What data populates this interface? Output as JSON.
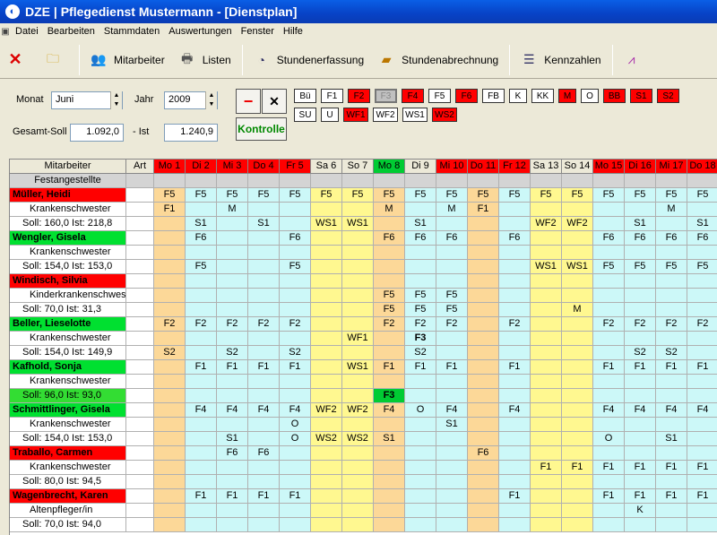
{
  "window": {
    "title": "DZE  |  Pflegedienst Mustermann - [Dienstplan]"
  },
  "menu": [
    "Datei",
    "Bearbeiten",
    "Stammdaten",
    "Auswertungen",
    "Fenster",
    "Hilfe"
  ],
  "toolbar": {
    "mitarbeiter": "Mitarbeiter",
    "listen": "Listen",
    "stundenerfassung": "Stundenerfassung",
    "stundenabrechnung": "Stundenabrechnung",
    "kennzahlen": "Kennzahlen"
  },
  "filter": {
    "monat_label": "Monat",
    "monat_value": "Juni",
    "jahr_label": "Jahr",
    "jahr_value": "2009",
    "gesamt_soll_label": "Gesamt-Soll",
    "gesamt_soll_value": "1.092,0",
    "ist_label": "- Ist",
    "ist_value": "1.240,9",
    "minus_label": "−",
    "close_label": "✕",
    "kontrolle_label": "Kontrolle"
  },
  "shift_buttons_row1": [
    {
      "label": "Bü",
      "style": "white"
    },
    {
      "label": "F1",
      "style": "white"
    },
    {
      "label": "F2",
      "style": "red"
    },
    {
      "label": "F3",
      "style": "gray"
    },
    {
      "label": "F4",
      "style": "redt"
    },
    {
      "label": "F5",
      "style": "white"
    },
    {
      "label": "F6",
      "style": "red"
    },
    {
      "label": "FB",
      "style": "white"
    },
    {
      "label": "K",
      "style": "white"
    },
    {
      "label": "KK",
      "style": "white"
    },
    {
      "label": "M",
      "style": "red"
    },
    {
      "label": "O",
      "style": "white"
    },
    {
      "label": "BB",
      "style": "red"
    },
    {
      "label": "S1",
      "style": "red"
    },
    {
      "label": "S2",
      "style": "red"
    }
  ],
  "shift_buttons_row2": [
    {
      "label": "SU",
      "style": "white"
    },
    {
      "label": "U",
      "style": "white"
    },
    {
      "label": "WF1",
      "style": "red"
    },
    {
      "label": "WF2",
      "style": "white"
    },
    {
      "label": "WS1",
      "style": "white"
    },
    {
      "label": "WS2",
      "style": "red"
    }
  ],
  "grid": {
    "col_mitarbeiter": "Mitarbeiter",
    "col_art": "Art",
    "days": [
      "Mo 1",
      "Di 2",
      "Mi 3",
      "Do 4",
      "Fr 5",
      "Sa 6",
      "So 7",
      "Mo 8",
      "Di 9",
      "Mi 10",
      "Do 11",
      "Fr 12",
      "Sa 13",
      "So 14",
      "Mo 15",
      "Di 16",
      "Mi 17",
      "Do 18"
    ],
    "day_header_styles": [
      "red",
      "red",
      "red",
      "red",
      "red",
      "plain",
      "plain",
      "green",
      "plain",
      "red",
      "red",
      "red",
      "plain",
      "plain",
      "red",
      "red",
      "red",
      "red"
    ],
    "day_types": [
      "mo",
      "wk",
      "wk",
      "wk",
      "wk",
      "we",
      "we",
      "mo",
      "wk",
      "wk",
      "mo",
      "wk",
      "we",
      "we",
      "wk",
      "wk",
      "wk",
      "wk"
    ],
    "group": "Festangestellte",
    "rows": [
      {
        "kind": "name",
        "label": "Müller, Heidi",
        "color": "red",
        "cells": [
          "F5",
          "F5",
          "F5",
          "F5",
          "F5",
          "F5",
          "F5",
          "F5",
          "F5",
          "F5",
          "F5",
          "F5",
          "F5",
          "F5",
          "F5",
          "F5",
          "F5",
          "F5"
        ]
      },
      {
        "kind": "sub",
        "label": "Krankenschwester",
        "cells": [
          "F1",
          "",
          "M",
          "",
          "",
          "",
          "",
          "M",
          "",
          "M",
          "F1",
          "",
          "",
          "",
          "",
          "",
          "M",
          ""
        ]
      },
      {
        "kind": "soll",
        "label": "Soll: 160,0 Ist: 218,8",
        "cells": [
          "",
          "S1",
          "",
          "S1",
          "",
          "WS1",
          "WS1",
          "",
          "S1",
          "",
          "",
          "",
          "WF2",
          "WF2",
          "",
          "S1",
          "",
          "S1"
        ]
      },
      {
        "kind": "name",
        "label": "Wengler, Gisela",
        "color": "green",
        "cells": [
          "",
          "F6",
          "",
          "",
          "F6",
          "",
          "",
          "F6",
          "F6",
          "F6",
          "",
          "F6",
          "",
          "",
          "F6",
          "F6",
          "F6",
          "F6"
        ]
      },
      {
        "kind": "sub",
        "label": "Krankenschwester",
        "cells": [
          "",
          "",
          "",
          "",
          "",
          "",
          "",
          "",
          "",
          "",
          "",
          "",
          "",
          "",
          "",
          "",
          "",
          ""
        ]
      },
      {
        "kind": "soll",
        "label": "Soll: 154,0 Ist: 153,0",
        "cells": [
          "",
          "F5",
          "",
          "",
          "F5",
          "",
          "",
          "",
          "",
          "",
          "",
          "",
          "WS1",
          "WS1",
          "F5",
          "F5",
          "F5",
          "F5"
        ]
      },
      {
        "kind": "name",
        "label": "Windisch, Silvia",
        "color": "red",
        "cells": [
          "",
          "",
          "",
          "",
          "",
          "",
          "",
          "",
          "",
          "",
          "",
          "",
          "",
          "",
          "",
          "",
          "",
          ""
        ]
      },
      {
        "kind": "sub",
        "label": "Kinderkrankenschwester",
        "cells": [
          "",
          "",
          "",
          "",
          "",
          "",
          "",
          "F5",
          "F5",
          "F5",
          "",
          "",
          "",
          "",
          "",
          "",
          "",
          ""
        ]
      },
      {
        "kind": "soll",
        "label": "Soll: 70,0 Ist: 31,3",
        "cells": [
          "",
          "",
          "",
          "",
          "",
          "",
          "",
          "F5",
          "F5",
          "F5",
          "",
          "",
          "",
          "M",
          "",
          "",
          "",
          ""
        ]
      },
      {
        "kind": "name",
        "label": "Beller, Lieselotte",
        "color": "green",
        "cells": [
          "F2",
          "F2",
          "F2",
          "F2",
          "F2",
          "",
          "",
          "F2",
          "F2",
          "F2",
          "",
          "F2",
          "",
          "",
          "F2",
          "F2",
          "F2",
          "F2"
        ]
      },
      {
        "kind": "sub",
        "label": "Krankenschwester",
        "cells": [
          "",
          "",
          "",
          "",
          "",
          "",
          "WF1",
          "",
          "F3b",
          "",
          "",
          "",
          "",
          "",
          "",
          "",
          "",
          ""
        ]
      },
      {
        "kind": "soll",
        "label": "Soll: 154,0 Ist: 149,9",
        "cells": [
          "S2",
          "",
          "S2",
          "",
          "S2",
          "",
          "",
          "",
          "S2",
          "",
          "",
          "",
          "",
          "",
          "",
          "S2",
          "S2",
          ""
        ]
      },
      {
        "kind": "name",
        "label": "Kafhold, Sonja",
        "color": "green",
        "cells": [
          "",
          "F1",
          "F1",
          "F1",
          "F1",
          "",
          "WS1",
          "F1",
          "F1",
          "F1",
          "",
          "F1",
          "",
          "",
          "F1",
          "F1",
          "F1",
          "F1"
        ]
      },
      {
        "kind": "sub",
        "label": "Krankenschwester",
        "cells": [
          "",
          "",
          "",
          "",
          "",
          "",
          "",
          "",
          "",
          "",
          "",
          "",
          "",
          "",
          "",
          "",
          "",
          ""
        ]
      },
      {
        "kind": "soll",
        "label": "Soll: 96,0 Ist: 93,0",
        "color": "green",
        "cells": [
          "",
          "",
          "",
          "",
          "",
          "",
          "",
          "F3g",
          "",
          "",
          "",
          "",
          "",
          "",
          "",
          "",
          "",
          ""
        ]
      },
      {
        "kind": "name",
        "label": "Schmittlinger, Gisela",
        "color": "green",
        "cells": [
          "",
          "F4",
          "F4",
          "F4",
          "F4",
          "WF2",
          "WF2",
          "F4",
          "O",
          "F4",
          "",
          "F4",
          "",
          "",
          "F4",
          "F4",
          "F4",
          "F4"
        ]
      },
      {
        "kind": "sub",
        "label": "Krankenschwester",
        "cells": [
          "",
          "",
          "",
          "",
          "O",
          "",
          "",
          "",
          "",
          "S1",
          "",
          "",
          "",
          "",
          "",
          "",
          "",
          ""
        ]
      },
      {
        "kind": "soll",
        "label": "Soll: 154,0 Ist: 153,0",
        "cells": [
          "",
          "",
          "S1",
          "",
          "O",
          "WS2",
          "WS2",
          "S1",
          "",
          "",
          "",
          "",
          "",
          "",
          "O",
          "",
          "S1",
          ""
        ]
      },
      {
        "kind": "name",
        "label": "Traballo, Carmen",
        "color": "red",
        "cells": [
          "",
          "",
          "F6",
          "F6",
          "",
          "",
          "",
          "",
          "",
          "",
          "F6",
          "",
          "",
          "",
          "",
          "",
          "",
          ""
        ]
      },
      {
        "kind": "sub",
        "label": "Krankenschwester",
        "cells": [
          "",
          "",
          "",
          "",
          "",
          "",
          "",
          "",
          "",
          "",
          "",
          "",
          "F1",
          "F1",
          "F1",
          "F1",
          "F1",
          "F1"
        ]
      },
      {
        "kind": "soll",
        "label": "Soll: 80,0 Ist: 94,5",
        "cells": [
          "",
          "",
          "",
          "",
          "",
          "",
          "",
          "",
          "",
          "",
          "",
          "",
          "",
          "",
          "",
          "",
          "",
          ""
        ]
      },
      {
        "kind": "name",
        "label": "Wagenbrecht, Karen",
        "color": "red",
        "cells": [
          "",
          "F1",
          "F1",
          "F1",
          "F1",
          "",
          "",
          "",
          "",
          "",
          "",
          "F1",
          "",
          "",
          "F1",
          "F1",
          "F1",
          "F1"
        ]
      },
      {
        "kind": "sub",
        "label": "Altenpfleger/in",
        "cells": [
          "",
          "",
          "",
          "",
          "",
          "",
          "",
          "",
          "",
          "",
          "",
          "",
          "",
          "",
          "",
          "K",
          "",
          ""
        ]
      },
      {
        "kind": "soll",
        "label": "Soll: 70,0 Ist: 94,0",
        "cells": [
          "",
          "",
          "",
          "",
          "",
          "",
          "",
          "",
          "",
          "",
          "",
          "",
          "",
          "",
          "",
          "",
          "",
          ""
        ]
      }
    ]
  }
}
